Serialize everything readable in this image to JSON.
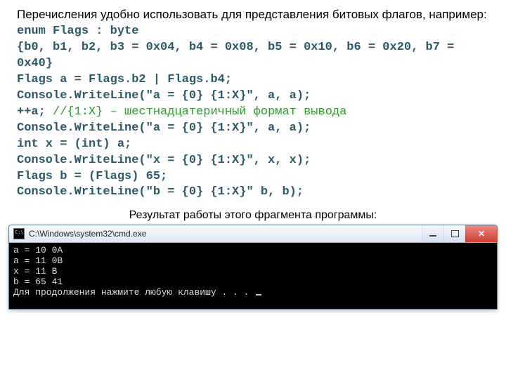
{
  "intro": "Перечисления удобно использовать для представления битовых флагов, например:",
  "code": {
    "l1": "enum Flags : byte",
    "l2": "{b0, b1, b2, b3 = 0x04, b4 = 0x08, b5 = 0x10, b6 = 0x20, b7 = 0x40}",
    "l3": "Flags a = Flags.b2 | Flags.b4;",
    "l4": "Console.WriteLine(\"a = {0} {1:X}\", a, a);",
    "l5a": "++a; ",
    "l5b": "//{1:X}",
    "l5c": " – шестнадцатеричный формат вывода",
    "l6": "Console.WriteLine(\"a = {0} {1:X}\", a, a);",
    "l7": "int x = (int) a;",
    "l8": "Console.WriteLine(\"x = {0} {1:X}\", x, x);",
    "l9": "Flags b = (Flags) 65;",
    "l10": "Console.WriteLine(\"b = {0} {1:X}\" b, b);"
  },
  "caption": "Результат работы этого фрагмента программы:",
  "console": {
    "title": "C:\\Windows\\system32\\cmd.exe",
    "out1": "a = 10 0A",
    "out2": "a = 11 0B",
    "out3": "x = 11 B",
    "out4": "b = 65 41",
    "prompt": "Для продолжения нажмите любую клавишу . . . "
  }
}
